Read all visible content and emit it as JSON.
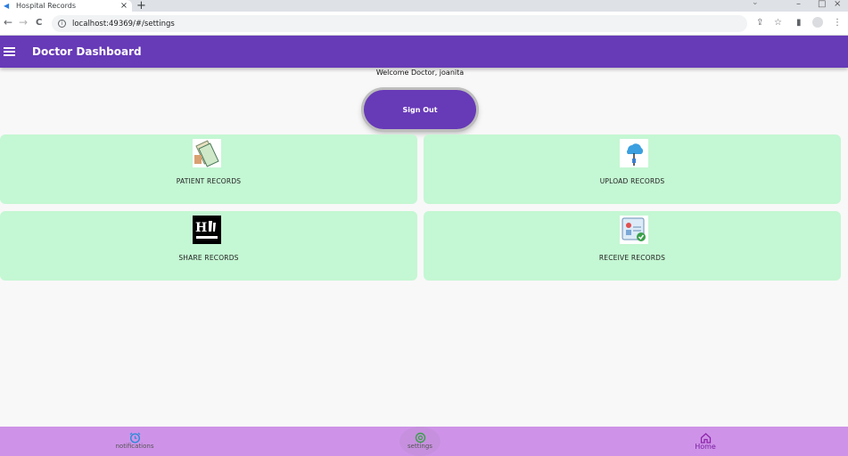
{
  "browser": {
    "tab_title": "Hospital Records",
    "tab_close": "×",
    "new_tab": "+",
    "url": "localhost:49369/#/settings",
    "back": "←",
    "forward": "→",
    "reload": "C"
  },
  "appbar": {
    "title": "Doctor Dashboard"
  },
  "welcome": "Welcome Doctor, joanita",
  "signout_label": "Sign Out",
  "cards": [
    {
      "label": "PATIENT RECORDS",
      "icon": "patient-records-icon"
    },
    {
      "label": "UPLOAD RECORDS",
      "icon": "upload-cloud-icon"
    },
    {
      "label": "SHARE RECORDS",
      "icon": "share-records-icon"
    },
    {
      "label": "RECEIVE RECORDS",
      "icon": "receive-records-icon"
    }
  ],
  "bottom_nav": [
    {
      "label": "notifications",
      "icon": "alarm-icon"
    },
    {
      "label": "settings",
      "icon": "settings-icon"
    },
    {
      "label": "Home",
      "icon": "home-icon"
    }
  ],
  "colors": {
    "primary": "#673ab7",
    "card_bg": "#c4f7d3",
    "bottom_nav_bg": "#ce93e8"
  }
}
